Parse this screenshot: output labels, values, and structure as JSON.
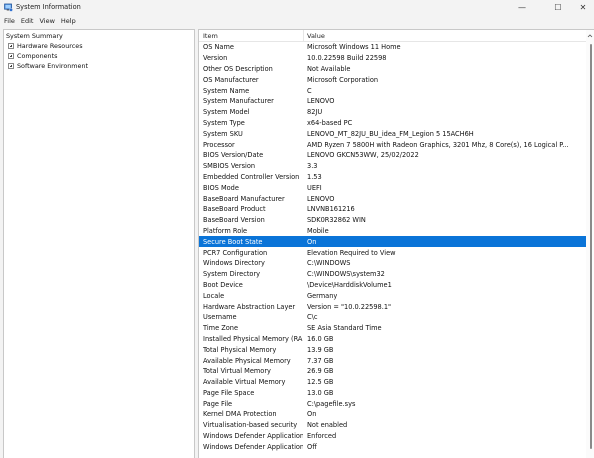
{
  "window": {
    "title": "System Information",
    "controls": {
      "minimize": "—",
      "maximize": "☐",
      "close": "✕"
    }
  },
  "menu": [
    "File",
    "Edit",
    "View",
    "Help"
  ],
  "tree": {
    "root": "System Summary",
    "children": [
      "Hardware Resources",
      "Components",
      "Software Environment"
    ]
  },
  "table": {
    "headers": {
      "item": "Item",
      "value": "Value"
    },
    "selected_row": "Secure Boot State",
    "rows": [
      {
        "item": "OS Name",
        "value": "Microsoft Windows 11 Home"
      },
      {
        "item": "Version",
        "value": "10.0.22598 Build 22598"
      },
      {
        "item": "Other OS Description",
        "value": "Not Available"
      },
      {
        "item": "OS Manufacturer",
        "value": "Microsoft Corporation"
      },
      {
        "item": "System Name",
        "value": "C"
      },
      {
        "item": "System Manufacturer",
        "value": "LENOVO"
      },
      {
        "item": "System Model",
        "value": "82JU"
      },
      {
        "item": "System Type",
        "value": "x64-based PC"
      },
      {
        "item": "System SKU",
        "value": "LENOVO_MT_82JU_BU_idea_FM_Legion 5 15ACH6H"
      },
      {
        "item": "Processor",
        "value": "AMD Ryzen 7 5800H with Radeon Graphics, 3201 Mhz, 8 Core(s), 16 Logical P..."
      },
      {
        "item": "BIOS Version/Date",
        "value": "LENOVO GKCN53WW, 25/02/2022"
      },
      {
        "item": "SMBIOS Version",
        "value": "3.3"
      },
      {
        "item": "Embedded Controller Version",
        "value": "1.53"
      },
      {
        "item": "BIOS Mode",
        "value": "UEFI"
      },
      {
        "item": "BaseBoard Manufacturer",
        "value": "LENOVO"
      },
      {
        "item": "BaseBoard Product",
        "value": "LNVNB161216"
      },
      {
        "item": "BaseBoard Version",
        "value": "SDK0R32862 WIN"
      },
      {
        "item": "Platform Role",
        "value": "Mobile"
      },
      {
        "item": "Secure Boot State",
        "value": "On"
      },
      {
        "item": "PCR7 Configuration",
        "value": "Elevation Required to View"
      },
      {
        "item": "Windows Directory",
        "value": "C:\\WINDOWS"
      },
      {
        "item": "System Directory",
        "value": "C:\\WINDOWS\\system32"
      },
      {
        "item": "Boot Device",
        "value": "\\Device\\HarddiskVolume1"
      },
      {
        "item": "Locale",
        "value": "Germany"
      },
      {
        "item": "Hardware Abstraction Layer",
        "value": "Version = \"10.0.22598.1\""
      },
      {
        "item": "Username",
        "value": "C\\c"
      },
      {
        "item": "Time Zone",
        "value": "SE Asia Standard Time"
      },
      {
        "item": "Installed Physical Memory (RAM)",
        "value": "16.0 GB"
      },
      {
        "item": "Total Physical Memory",
        "value": "13.9 GB"
      },
      {
        "item": "Available Physical Memory",
        "value": "7.37 GB"
      },
      {
        "item": "Total Virtual Memory",
        "value": "26.9 GB"
      },
      {
        "item": "Available Virtual Memory",
        "value": "12.5 GB"
      },
      {
        "item": "Page File Space",
        "value": "13.0 GB"
      },
      {
        "item": "Page File",
        "value": "C:\\pagefile.sys"
      },
      {
        "item": "Kernel DMA Protection",
        "value": "On"
      },
      {
        "item": "Virtualisation-based security",
        "value": "Not enabled"
      },
      {
        "item": "Windows Defender Application...",
        "value": "Enforced"
      },
      {
        "item": "Windows Defender Application...",
        "value": "Off"
      }
    ]
  },
  "colors": {
    "selection": "#0a74d8",
    "window_bg": "#f3f3f3",
    "pane_bg": "#ffffff"
  },
  "icons": {
    "app": "system-information-icon",
    "scroll_up": "chevron-up-icon"
  }
}
